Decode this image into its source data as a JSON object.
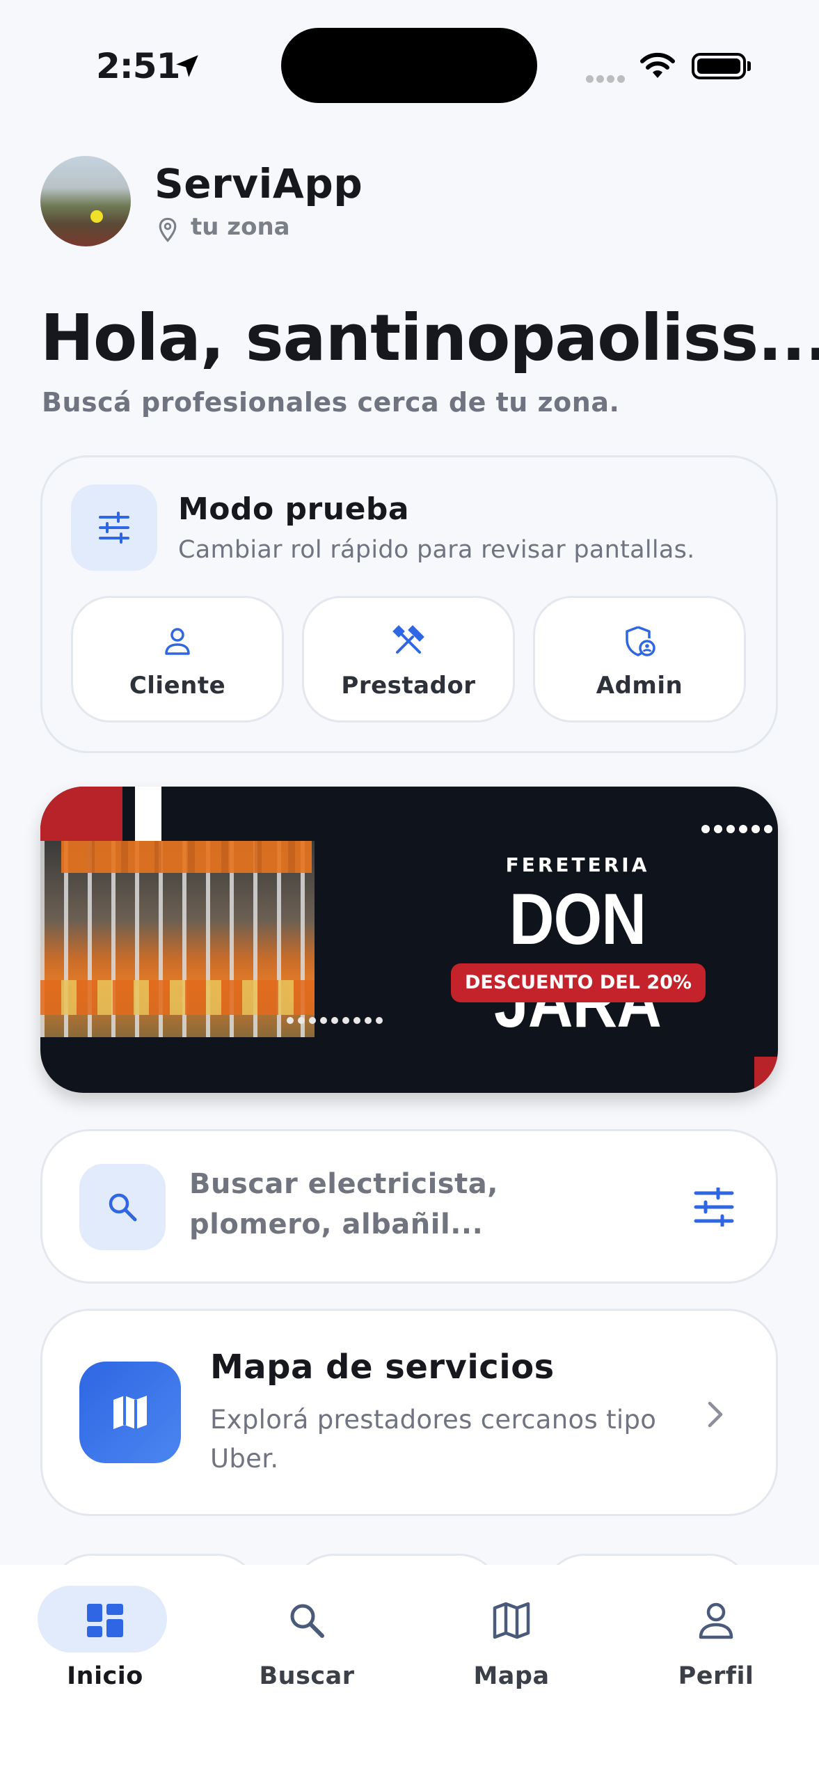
{
  "status_bar": {
    "time": "2:51"
  },
  "header": {
    "app_name": "ServiApp",
    "location": "tu zona"
  },
  "greeting": {
    "title": "Hola, santinopaoliss...",
    "subtitle": "Buscá profesionales cerca de tu zona."
  },
  "test_mode": {
    "title": "Modo prueba",
    "subtitle": "Cambiar rol rápido para revisar pantallas.",
    "roles": [
      {
        "label": "Cliente",
        "icon": "person-icon"
      },
      {
        "label": "Prestador",
        "icon": "tools-icon"
      },
      {
        "label": "Admin",
        "icon": "shield-admin-icon"
      }
    ]
  },
  "banner": {
    "kicker": "FERETERIA",
    "brand": "DON JARA",
    "discount": "DESCUENTO DEL 20%"
  },
  "search": {
    "placeholder": "Buscar electricista, plomero, albañil..."
  },
  "map_card": {
    "title": "Mapa de servicios",
    "subtitle": "Explorá prestadores cercanos tipo Uber."
  },
  "tabbar": {
    "items": [
      {
        "label": "Inicio",
        "icon": "dashboard-icon",
        "active": true
      },
      {
        "label": "Buscar",
        "icon": "search-icon",
        "active": false
      },
      {
        "label": "Mapa",
        "icon": "map-icon",
        "active": false
      },
      {
        "label": "Perfil",
        "icon": "person-icon",
        "active": false
      }
    ]
  },
  "colors": {
    "accent": "#2f66e3",
    "accent_light": "#e2ebfb",
    "banner_red": "#c4232b",
    "banner_bg": "#0f141c"
  }
}
